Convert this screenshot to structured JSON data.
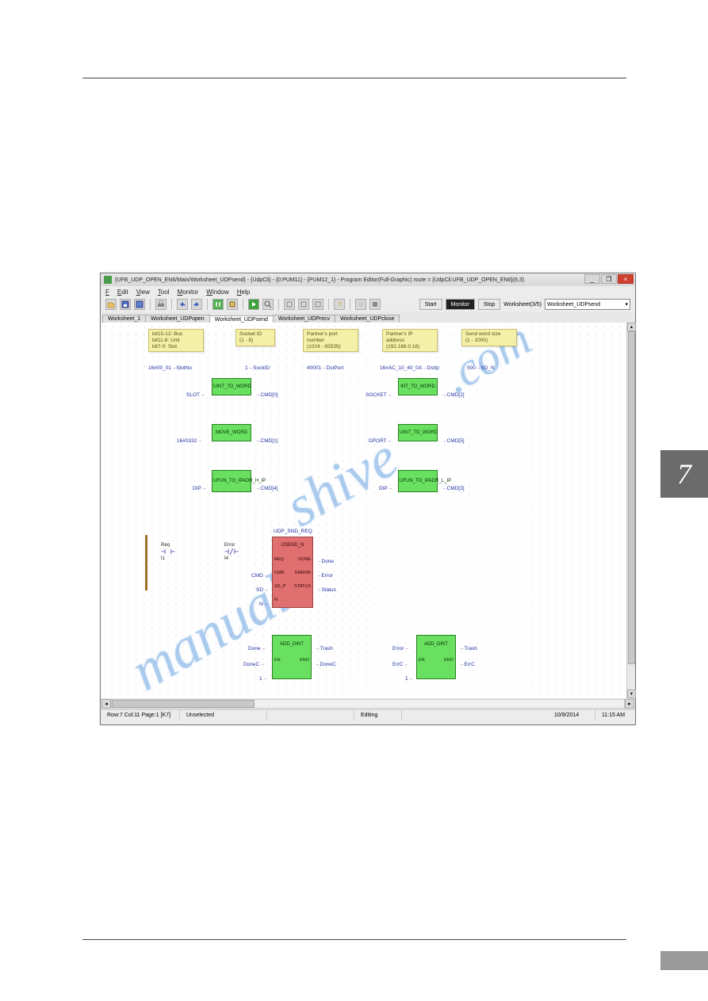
{
  "side_tab": "7",
  "window": {
    "title": "{UFB_UDP_OPEN_EN6/Main/Worksheet_UDPsend} - {UdpCli} - {0:PUM11} - {PUM12_1} - Program Editor(Full-Graphic)  route = {UdpCli:UFB_UDP_OPEN_EN6}(6,3)",
    "minimize": "_",
    "maximize": "❐",
    "close": "×"
  },
  "menu": {
    "file": "File",
    "edit": "Edit",
    "view": "View",
    "tool": "Tool",
    "monitor": "Monitor",
    "window": "Window",
    "help": "Help"
  },
  "toolbar": {
    "start": "Start",
    "monitor": "Monitor",
    "stop": "Stop",
    "ws_label": "Worksheet(3/5)",
    "ws_selected": "Worksheet_UDPsend"
  },
  "tabs": [
    "Worksheet_1",
    "Worksheet_UDPopen",
    "Worksheet_UDPsend",
    "Worksheet_UDPrecv",
    "Worksheet_UDPclose"
  ],
  "active_tab": 2,
  "notes": {
    "slot": "bit15-12: Bus\nbit11-8: Unit\nbit7-0: Slot",
    "socket": "Socket ID\n(1 - 8)",
    "port": "Partner's port\nnumber\n(1024 - 65535)",
    "ip": "Partner's IP\naddress\n(192.168.0.16)",
    "wsize": "Send word size\n(1 - 1000)"
  },
  "consts": {
    "slot": "16#00_01",
    "slotno": "SlotNo",
    "sock": "1",
    "sockid": "SockID",
    "port": "40001",
    "dstport": "DstPort",
    "ip": "16#AC_10_40_0A",
    "dstip": "DstIp",
    "wsize": "500",
    "sdn": "SD_N"
  },
  "blocks": {
    "b1": {
      "name": "UINT_TO_WORD",
      "in": "SLOT",
      "out": "CMD[0]"
    },
    "b2": {
      "name": "MOVE_WORD",
      "in": "16#0332",
      "out": "CMD[1]"
    },
    "b3": {
      "name": "UFUN_TO_IPADR_H_IP",
      "in": "DIP",
      "out": "CMD[4]"
    },
    "b4": {
      "name": "INT_TO_WORD",
      "in": "SOCKET",
      "out": "CMD[2]"
    },
    "b5": {
      "name": "UINT_TO_WORD",
      "in": "DPORT",
      "out": "CMD[5]"
    },
    "b6": {
      "name": "UFUN_TO_IPADR_L_IP",
      "in": "DIP",
      "out": "CMD[3]"
    },
    "udp": {
      "title": "UDP_SND_REQ",
      "name": "USEND_N",
      "rows": [
        [
          "REQ",
          "DONE"
        ],
        [
          "CMD",
          "ERROR"
        ],
        [
          "SD_P",
          "STATUS"
        ],
        [
          "N",
          ""
        ]
      ],
      "in_labels": [
        "Req",
        "Error",
        "CMD",
        "SD",
        "N"
      ],
      "out_labels": [
        "Done",
        "Error",
        "Status"
      ]
    },
    "add1": {
      "name": "ADD_DINT",
      "l1": "EN",
      "r1": "ENO",
      "in1": "Done",
      "out1": "Trash",
      "in2": "DoneC",
      "out2": "DoneC",
      "in3": "1"
    },
    "add2": {
      "name": "ADD_DINT",
      "l1": "EN",
      "r1": "ENO",
      "in1": "Error",
      "out1": "Trash",
      "in2": "ErrC",
      "out2": "ErrC",
      "in3": "1"
    }
  },
  "ladder": {
    "req": "Req",
    "i1": "I1",
    "err": "Error",
    "i4": "I4"
  },
  "status": {
    "pos": "Row:7  Col:11  Page:1  [K7]",
    "sel": "Unselected",
    "mode": "Editing",
    "date": "10/9/2014",
    "time": "11:15 AM"
  },
  "watermark": "manualshive.com"
}
